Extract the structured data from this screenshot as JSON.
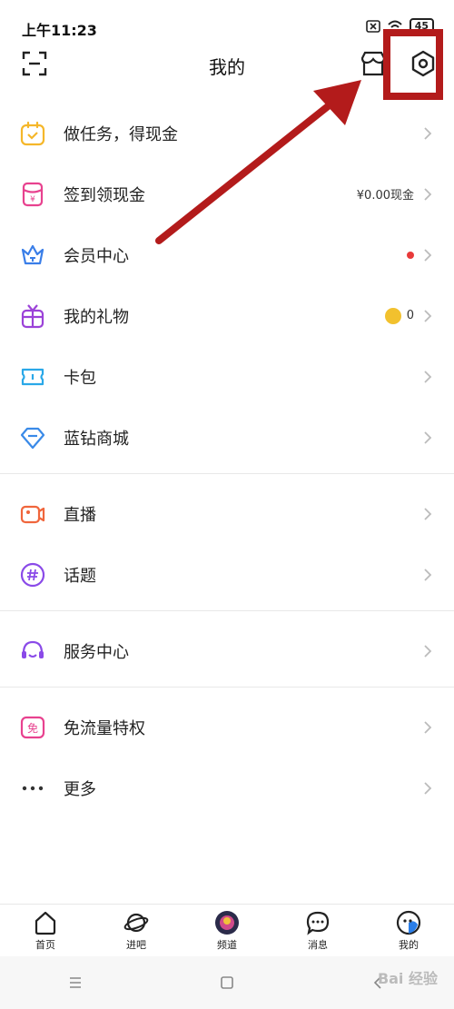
{
  "status": {
    "time": "上午11:23",
    "battery": "45"
  },
  "header": {
    "title": "我的"
  },
  "menu": {
    "tasks": {
      "label": "做任务，得现金"
    },
    "checkin": {
      "label": "签到领现金",
      "extra": "¥0.00现金"
    },
    "member": {
      "label": "会员中心"
    },
    "gifts": {
      "label": "我的礼物",
      "extra": "0"
    },
    "cards": {
      "label": "卡包"
    },
    "store": {
      "label": "蓝钻商城"
    },
    "live": {
      "label": "直播"
    },
    "topics": {
      "label": "话题"
    },
    "service": {
      "label": "服务中心"
    },
    "freeflow": {
      "label": "免流量特权"
    },
    "more": {
      "label": "更多"
    }
  },
  "tabs": [
    "首页",
    "进吧",
    "频道",
    "消息",
    "我的"
  ],
  "watermark": "Bai 经验",
  "colors": {
    "highlight": "#b31b1b",
    "accent_purple": "#7a4ef0",
    "badge_red": "#e83a3a"
  },
  "icons": {
    "scan": "scan-icon",
    "shop": "shop-icon",
    "settings": "settings-icon",
    "tasks": "calendar-icon",
    "checkin": "redenvelope-icon",
    "member": "crown-icon",
    "gifts": "gift-icon",
    "cards": "ticket-icon",
    "store": "diamond-icon",
    "live": "camera-icon",
    "topics": "hashtag-icon",
    "service": "headset-icon",
    "freeflow": "free-icon",
    "more": "more-icon"
  }
}
